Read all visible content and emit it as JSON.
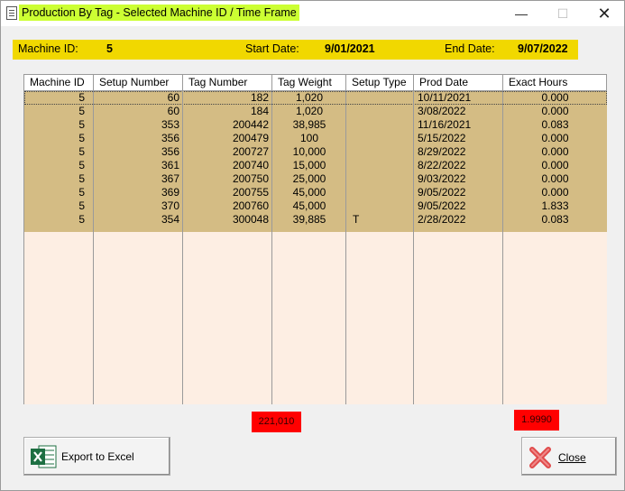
{
  "window": {
    "title": "Production By Tag - Selected Machine ID / Time Frame",
    "min_glyph": "—",
    "max_glyph": "☐",
    "close_glyph": "✕"
  },
  "info": {
    "machine_id_label": "Machine ID:",
    "machine_id_value": "5",
    "start_date_label": "Start Date:",
    "start_date_value": "9/01/2021",
    "end_date_label": "End Date:",
    "end_date_value": "9/07/2022"
  },
  "table": {
    "headers": [
      "Machine ID",
      "Setup Number",
      "Tag Number",
      "Tag Weight",
      "Setup Type",
      "Prod Date",
      "Exact Hours"
    ],
    "rows": [
      [
        "5",
        "60",
        "182",
        "1,020",
        "",
        "10/11/2021",
        "0.000"
      ],
      [
        "5",
        "60",
        "184",
        "1,020",
        "",
        "3/08/2022",
        "0.000"
      ],
      [
        "5",
        "353",
        "200442",
        "38,985",
        "",
        "11/16/2021",
        "0.083"
      ],
      [
        "5",
        "356",
        "200479",
        "100",
        "",
        "5/15/2022",
        "0.000"
      ],
      [
        "5",
        "356",
        "200727",
        "10,000",
        "",
        "8/29/2022",
        "0.000"
      ],
      [
        "5",
        "361",
        "200740",
        "15,000",
        "",
        "8/22/2022",
        "0.000"
      ],
      [
        "5",
        "367",
        "200750",
        "25,000",
        "",
        "9/03/2022",
        "0.000"
      ],
      [
        "5",
        "369",
        "200755",
        "45,000",
        "",
        "9/05/2022",
        "0.000"
      ],
      [
        "5",
        "370",
        "200760",
        "45,000",
        "",
        "9/05/2022",
        "1.833"
      ],
      [
        "5",
        "354",
        "300048",
        "39,885",
        "T",
        "2/28/2022",
        "0.083"
      ]
    ],
    "selected_row": 0
  },
  "totals": {
    "tag_weight": "221,010",
    "exact_hours": "1.9990"
  },
  "buttons": {
    "export_label": "Export to Excel",
    "close_label": "Close"
  },
  "icons": {
    "app": "document-icon",
    "export": "excel-icon",
    "close": "red-x-icon"
  },
  "colors": {
    "title_highlight": "#ccff33",
    "info_bar": "#f1d800",
    "row_background": "#d4bc84",
    "grid_background": "#fdeee3",
    "total_background": "#ff0000",
    "excel_green": "#1d6f42",
    "close_red": "#e04b4b"
  }
}
